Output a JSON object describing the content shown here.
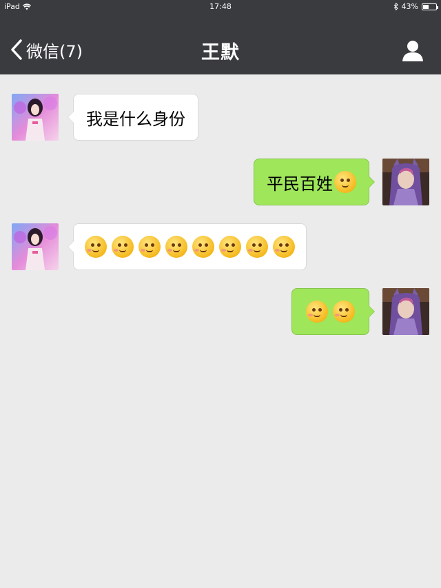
{
  "status_bar": {
    "carrier": "iPad",
    "time": "17:48",
    "battery": "43%",
    "battery_level": 0.43
  },
  "nav": {
    "back_label": "微信(7)",
    "title": "王默"
  },
  "messages": [
    {
      "direction": "incoming",
      "text": "我是什么身份"
    },
    {
      "direction": "outgoing",
      "text": "平民百姓"
    },
    {
      "direction": "incoming",
      "emoji_count": 8
    },
    {
      "direction": "outgoing",
      "emoji_count": 2
    }
  ],
  "colors": {
    "nav_bg": "#3a3b3f",
    "chat_bg": "#ebebeb",
    "incoming_bubble": "#ffffff",
    "outgoing_bubble": "#9fe65b"
  }
}
